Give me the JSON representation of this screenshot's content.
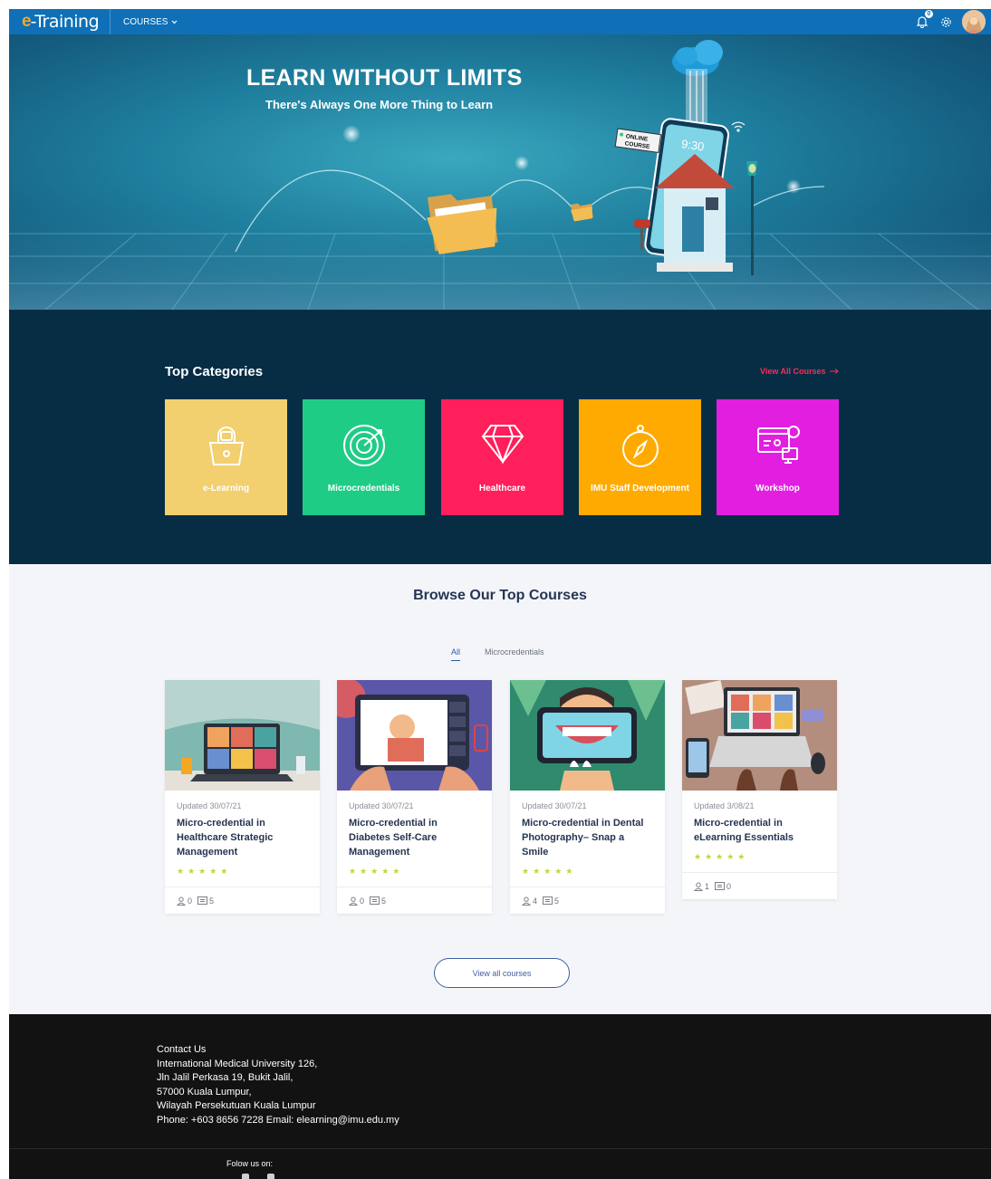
{
  "navbar": {
    "brand_e": "e",
    "brand_rest": "-Training",
    "courses_label": "COURSES",
    "notification_count": "0"
  },
  "hero": {
    "title": "LEARN WITHOUT LIMITS",
    "subtitle": "There's Always One More Thing to Learn",
    "sign_text": "ONLINE COURSE",
    "phone_time": "9:30"
  },
  "top_categories": {
    "title": "Top Categories",
    "view_all": "View All Courses",
    "items": [
      {
        "label": "e-Learning",
        "color": "#f2cf6f",
        "icon": "shopping-bag-icon"
      },
      {
        "label": "Microcredentials",
        "color": "#1fcc86",
        "icon": "target-icon"
      },
      {
        "label": "Healthcare",
        "color": "#ff1f5a",
        "icon": "diamond-icon"
      },
      {
        "label": "IMU Staff Development",
        "color": "#ffaa00",
        "icon": "compass-icon"
      },
      {
        "label": "Workshop",
        "color": "#e21fe0",
        "icon": "web-design-icon"
      }
    ]
  },
  "browse": {
    "title": "Browse Our Top Courses",
    "tabs": [
      "All",
      "Microcredentials"
    ],
    "view_all_btn": "View all courses",
    "courses": [
      {
        "date": "Updated 30/07/21",
        "title": "Micro-credential in Healthcare Strategic Management",
        "stars": "★★★★★",
        "users": "0",
        "lessons": "5"
      },
      {
        "date": "Updated 30/07/21",
        "title": "Micro-credential in Diabetes Self-Care Management",
        "stars": "★★★★★",
        "users": "0",
        "lessons": "5"
      },
      {
        "date": "Updated 30/07/21",
        "title": "Micro-credential in Dental Photography– Snap a Smile",
        "stars": "★★★★★",
        "users": "4",
        "lessons": "5"
      },
      {
        "date": "Updated 3/08/21",
        "title": "Micro-credential in eLearning Essentials",
        "stars": "★★★★★",
        "users": "1",
        "lessons": "0"
      }
    ]
  },
  "footer": {
    "contact_title": "Contact Us",
    "address_lines": [
      "International Medical University 126,",
      "Jln Jalil Perkasa 19, Bukit Jalil,",
      "57000 Kuala Lumpur,",
      "Wilayah Persekutuan Kuala Lumpur",
      "Phone: +603 8656 7228 Email: elearning@imu.edu.my"
    ],
    "follow": "Folow us on:"
  }
}
